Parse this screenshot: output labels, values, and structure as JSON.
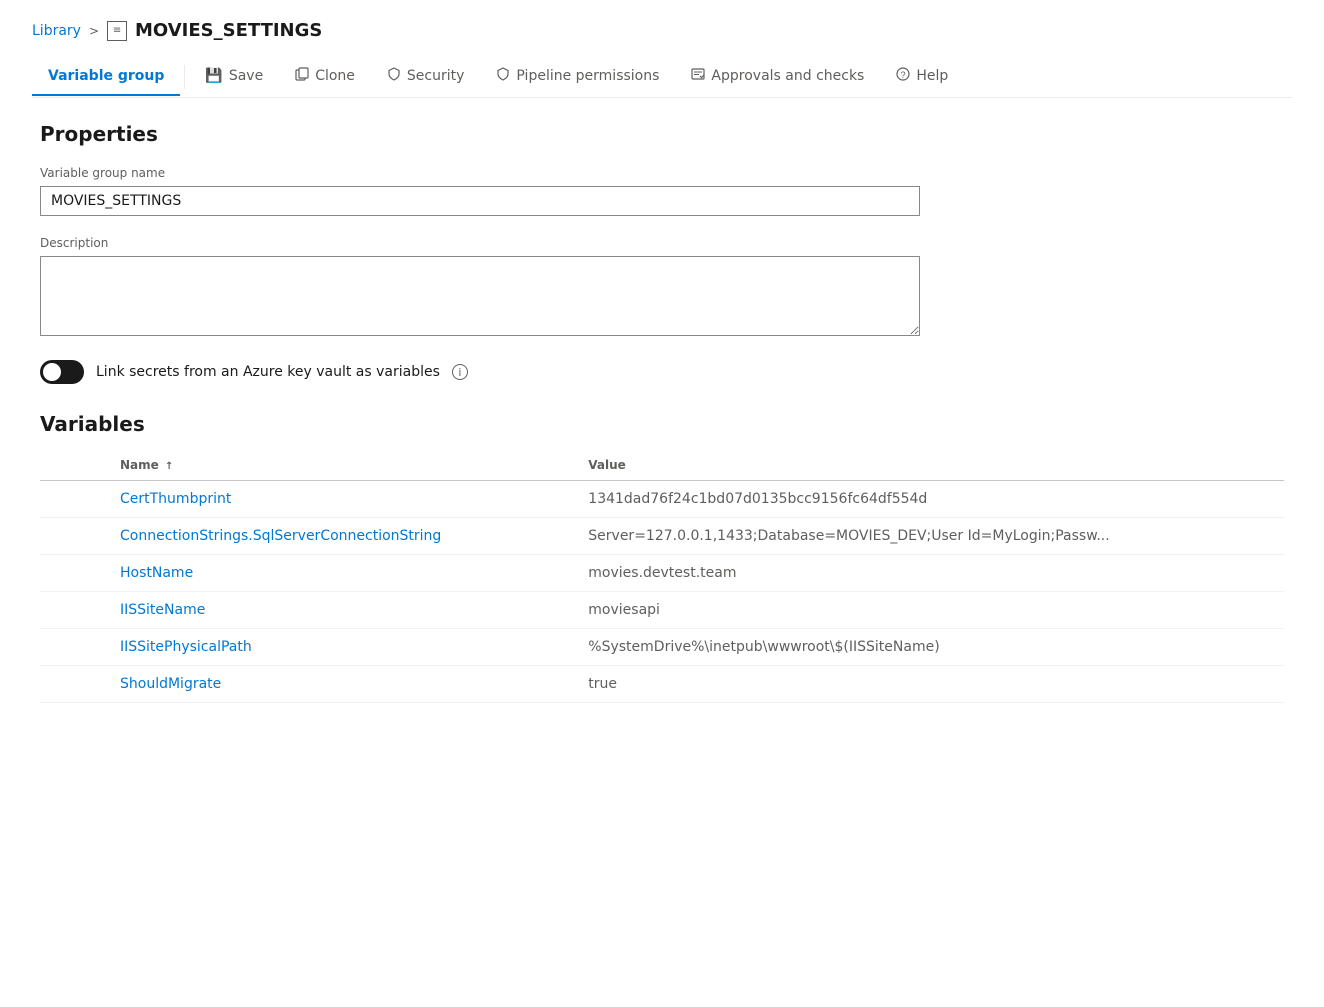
{
  "breadcrumb": {
    "library_label": "Library",
    "separator": ">",
    "page_title": "MOVIES_SETTINGS"
  },
  "toolbar": {
    "tab_variable_group": "Variable group",
    "btn_save": "Save",
    "btn_clone": "Clone",
    "btn_security": "Security",
    "btn_pipeline_permissions": "Pipeline permissions",
    "btn_approvals": "Approvals and checks",
    "btn_help": "Help"
  },
  "properties": {
    "section_title": "Properties",
    "variable_group_name_label": "Variable group name",
    "variable_group_name_value": "MOVIES_SETTINGS",
    "description_label": "Description",
    "description_placeholder": "",
    "toggle_label": "Link secrets from an Azure key vault as variables",
    "info_icon_char": "i"
  },
  "variables": {
    "section_title": "Variables",
    "col_name": "Name",
    "sort_indicator": "↑",
    "col_value": "Value",
    "rows": [
      {
        "name": "CertThumbprint",
        "value": "1341dad76f24c1bd07d0135bcc9156fc64df554d"
      },
      {
        "name": "ConnectionStrings.SqlServerConnectionString",
        "value": "Server=127.0.0.1,1433;Database=MOVIES_DEV;User Id=MyLogin;Passw..."
      },
      {
        "name": "HostName",
        "value": "movies.devtest.team"
      },
      {
        "name": "IISSiteName",
        "value": "moviesapi"
      },
      {
        "name": "IISSitePhysicalPath",
        "value": "%SystemDrive%\\inetpub\\wwwroot\\$(IISSiteName)"
      },
      {
        "name": "ShouldMigrate",
        "value": "true"
      }
    ]
  },
  "icons": {
    "save": "💾",
    "clone": "📋",
    "shield": "🛡",
    "help": "?"
  }
}
